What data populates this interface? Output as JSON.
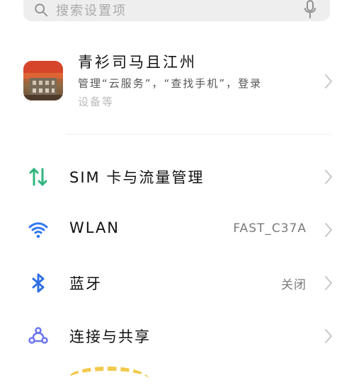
{
  "search": {
    "placeholder": "搜索设置项"
  },
  "account": {
    "name": "青衫司马且江州",
    "description_line1": "管理“云服务”，“查找手机”，登录",
    "description_line2": "设备等"
  },
  "settings": [
    {
      "label": "SIM 卡与流量管理",
      "value": "",
      "icon": "sim-data-icon",
      "color": "#2fb67d"
    },
    {
      "label": "WLAN",
      "value": "FAST_C37A",
      "icon": "wifi-icon",
      "color": "#2f78f0"
    },
    {
      "label": "蓝牙",
      "value": "关闭",
      "icon": "bluetooth-icon",
      "color": "#2f6fe4"
    },
    {
      "label": "连接与共享",
      "value": "",
      "icon": "share-icon",
      "color": "#6b74f0"
    }
  ],
  "colors": {
    "background": "#ffffff",
    "search_background": "#eeeeee",
    "text_primary": "#111111",
    "text_secondary": "#7a7a7a",
    "chevron": "#c7c7c7"
  }
}
